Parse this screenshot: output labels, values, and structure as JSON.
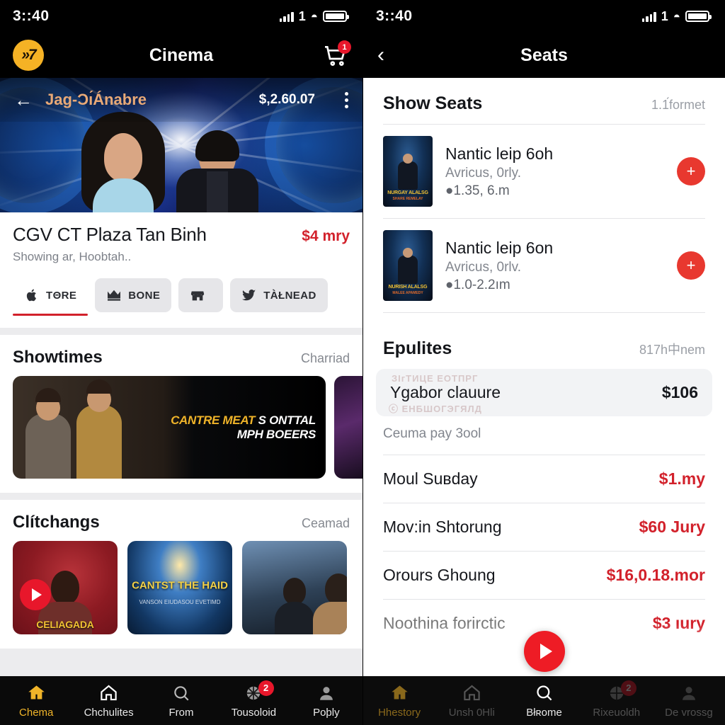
{
  "left": {
    "status": {
      "time": "3::40",
      "carrier": "1",
      "wifi_icon": "wifi-icon",
      "battery_icon": "battery-full-icon",
      "signal_icon": "signal-bars-icon"
    },
    "appbar": {
      "logo": "»7",
      "title": "Cinema",
      "cart_icon": "cart-icon",
      "cart_badge": "1"
    },
    "hero_overlay": {
      "back_icon": "arrow-left-icon",
      "title": "Jag-Ɔı́Ánabre",
      "price": "$,2.60.07",
      "menu_icon": "more-vertical-icon"
    },
    "venue": {
      "name": "CGV CT Plaza Tan Binh",
      "price": "$4 mry",
      "subtitle": "Showing ar, Hoobtah..",
      "chips": [
        {
          "label": "TΘRE",
          "icon": "apple-icon",
          "active": true
        },
        {
          "label": "BONE",
          "icon": "crown-icon",
          "active": false
        },
        {
          "label": "",
          "icon": "storefront-icon",
          "active": false
        },
        {
          "label": "TÀŁNEAD",
          "icon": "twitter-bird-icon",
          "active": false
        }
      ]
    },
    "showtimes": {
      "title": "Showtimes",
      "action": "Charriad",
      "cards": [
        {
          "line1_a": "CANTRE MEAT",
          "line1_b": "S ONTTAL",
          "line2": "MPH BOEERS"
        }
      ]
    },
    "clitchangs": {
      "title": "Clítchangs",
      "action": "Ceamad",
      "posters": [
        {
          "title": "CELIAGADA",
          "subtitle": ""
        },
        {
          "title": "CANTST THE HAID",
          "subtitle": "VANSON EIUDASOU EVETIMD"
        },
        {
          "title": "",
          "subtitle": ""
        }
      ],
      "play_icon": "play-circle-icon"
    },
    "bottom_nav": [
      {
        "label": "Chema",
        "icon": "home-filled-icon",
        "active": true,
        "badge": ""
      },
      {
        "label": "Chchulites",
        "icon": "home-outline-icon",
        "active": false,
        "badge": ""
      },
      {
        "label": "From",
        "icon": "search-icon",
        "active": false,
        "badge": ""
      },
      {
        "label": "Tousoloid",
        "icon": "wheel-icon",
        "active": false,
        "badge": "2"
      },
      {
        "label": "Poþly",
        "icon": "person-icon",
        "active": false,
        "badge": ""
      }
    ]
  },
  "right": {
    "status": {
      "time": "3::40",
      "carrier": "1",
      "wifi_icon": "wifi-icon",
      "battery_icon": "battery-full-icon",
      "signal_icon": "signal-bars-icon"
    },
    "appbar": {
      "back_icon": "chevron-left-icon",
      "title": "Seats"
    },
    "show_seats": {
      "title": "Show Seats",
      "meta": "1.1́formet",
      "rows": [
        {
          "title": "Nantic leip 6oh",
          "sub": "Avricus, 0rly.",
          "meta": "●1.35, 6.m",
          "add_icon": "plus-circle-icon",
          "poster_title": "NURGAY ALALSG",
          "poster_sub": "SHARE REMELAY"
        },
        {
          "title": "Nantic leip 6on",
          "sub": "Avricus, 0rlv.",
          "meta": "●1.0-2.2ım",
          "add_icon": "plus-circle-icon",
          "poster_title": "NURISH ALALSG",
          "poster_sub": "MALEE APAMEDY"
        }
      ]
    },
    "epulites": {
      "title": "Epulites",
      "meta": "817h中nem",
      "highlight": {
        "ghost_top": "ЗІгТИЦЕ ЕОТПРГ",
        "label": "Ygabor clauure",
        "value": "$106",
        "ghost_bottom": "ⓒ ЕНБШОГЭГЯЛД"
      },
      "note": "Ceuma pay 3ool",
      "rows": [
        {
          "label": "Moul Suʙday",
          "value": "$1.my",
          "red": true
        },
        {
          "label": "Mov:in Shtorung",
          "value": "$60 Jury",
          "red": true
        },
        {
          "label": "Orours Ghoung",
          "value": "$16,0.18.mor",
          "red": true
        },
        {
          "label": "Noothinа forirctic",
          "value": "$3 ıury",
          "red": true
        }
      ]
    },
    "fab": {
      "icon": "play-circle-icon"
    },
    "bottom_nav": [
      {
        "label": "Hhestory",
        "icon": "home-filled-icon",
        "state": "gold",
        "badge": ""
      },
      {
        "label": "Unsh 0Hli",
        "icon": "home-outline-icon",
        "state": "dim",
        "badge": ""
      },
      {
        "label": "Błʀome",
        "icon": "search-icon",
        "state": "lit",
        "badge": ""
      },
      {
        "label": "Rixeuoldh",
        "icon": "wheel-icon",
        "state": "dim",
        "badge": "2"
      },
      {
        "label": "De vrossg",
        "icon": "person-icon",
        "state": "dim",
        "badge": ""
      }
    ]
  },
  "colors": {
    "accent_red": "#E8172B",
    "price_red": "#D2212B",
    "brand_yellow": "#F0B429",
    "app_black": "#000000"
  }
}
